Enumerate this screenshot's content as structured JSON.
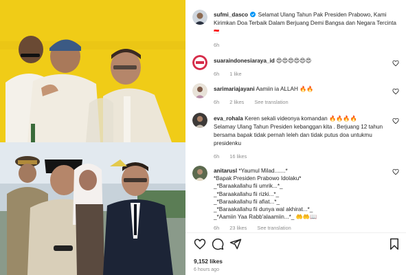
{
  "post": {
    "author": "sufmi_dasco",
    "caption": "Selamat Ulang Tahun Pak Presiden Prabowo, Kami Kirimkan Doa Terbaik Dalam Berjuang Demi Bangsa dan Negara Tercinta",
    "caption_suffix": "🇮🇩",
    "time": "6h"
  },
  "comments": [
    {
      "user": "suaraindonesiaraya_id",
      "text": "😍😍😍😍😍😍",
      "time": "6h",
      "likes": "1 like",
      "reply": "",
      "see_translation": ""
    },
    {
      "user": "sarimariajayani",
      "text": "Aamiin ia ALLAH 🔥🔥",
      "time": "6h",
      "likes": "2 likes",
      "reply": "",
      "see_translation": "See translation"
    },
    {
      "user": "eva_rohala",
      "text": "Keren sekali videonya komandan 🔥🔥🔥🔥",
      "text2": "Selamay Ulang Tahun Presiden kebanggan kita . Berjuang 12 tahun bersama bapak tidak pernah leleh dan tidak putus doa untukmu presidenku",
      "time": "6h",
      "likes": "16 likes",
      "reply": "",
      "see_translation": ""
    },
    {
      "user": "anitarusl",
      "lines": [
        "*Yaumul Milad.......*",
        "*Bapak Presiden Prabowo Idolaku*",
        "_*Baraakallahu fii umrik...*_",
        "_*Baraakallahu fii rizki...*_",
        "_*Baraakallahu fii afiat...*_",
        "_*Baraakallahu fii dunya wal akhirat...*_",
        "_*Aamiin Yaa Rabb'alaamiin...*_ 🤲🤲📖"
      ],
      "time": "6h",
      "likes": "23 likes",
      "reply": "",
      "see_translation": "See translation"
    }
  ],
  "footer": {
    "likes": "9,152 likes",
    "ago": "6 hours ago"
  },
  "icons": [
    "heart-icon",
    "comment-icon",
    "share-icon",
    "bookmark-icon",
    "verified-icon"
  ],
  "colors": {
    "verified": "#0095f6",
    "muted": "#8e8e8e",
    "text": "#262626"
  }
}
